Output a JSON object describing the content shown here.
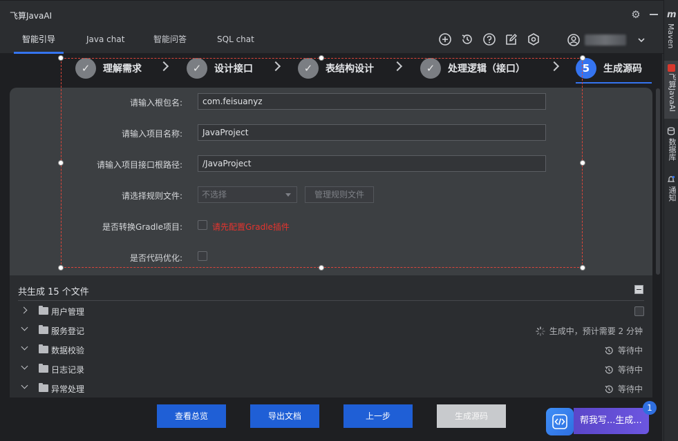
{
  "app": {
    "title": "飞算JavaAI"
  },
  "tabs": [
    {
      "label": "智能引导",
      "active": true
    },
    {
      "label": "Java chat",
      "active": false
    },
    {
      "label": "智能问答",
      "active": false
    },
    {
      "label": "SQL chat",
      "active": false
    }
  ],
  "toolbar_icons": [
    "plus-circle-icon",
    "history-icon",
    "help-icon",
    "edit-icon",
    "settings-hex-icon",
    "user-icon",
    "chevron-down-icon"
  ],
  "right_stripe": {
    "maven": "Maven",
    "javaai": "飞算JavaAI",
    "database": "数据库",
    "notify": "通知"
  },
  "steps": [
    {
      "label": "理解需求",
      "state": "done"
    },
    {
      "label": "设计接口",
      "state": "done"
    },
    {
      "label": "表结构设计",
      "state": "done"
    },
    {
      "label": "处理逻辑（接口）",
      "state": "done"
    },
    {
      "label": "生成源码",
      "state": "current",
      "number": "5"
    }
  ],
  "form": {
    "package_label": "请输入根包名:",
    "package_value": "com.feisuanyz",
    "project_name_label": "请输入项目名称:",
    "project_name_value": "JavaProject",
    "root_path_label": "请输入项目接口根路径:",
    "root_path_value": "/JavaProject",
    "rule_file_label": "请选择规则文件:",
    "rule_file_select": "不选择",
    "manage_rules_button": "管理规则文件",
    "gradle_label": "是否转换Gradle项目:",
    "gradle_warning": "请先配置Gradle插件",
    "optimize_label": "是否代码优化:"
  },
  "files": {
    "header": "共生成 15 个文件",
    "rows": [
      {
        "name": "用户管理",
        "expanded": false,
        "status": "",
        "status_icon": "checkbox"
      },
      {
        "name": "服务登记",
        "expanded": true,
        "status": "生成中，预计需要 2 分钟",
        "status_icon": "spinner-icon"
      },
      {
        "name": "数据校验",
        "expanded": true,
        "status": "等待中",
        "status_icon": "clock-icon"
      },
      {
        "name": "日志记录",
        "expanded": true,
        "status": "等待中",
        "status_icon": "clock-icon"
      },
      {
        "name": "异常处理",
        "expanded": true,
        "status": "等待中",
        "status_icon": "clock-icon"
      }
    ]
  },
  "buttons": {
    "overview": "查看总览",
    "export": "导出文档",
    "prev": "上一步",
    "generate": "生成源码"
  },
  "assist": {
    "label": "帮我写...生成...",
    "badge": "1"
  },
  "colors": {
    "accent": "#3574f0",
    "primary_button": "#1f5fd6",
    "warning": "#e5342e",
    "selection": "#e0453a"
  }
}
